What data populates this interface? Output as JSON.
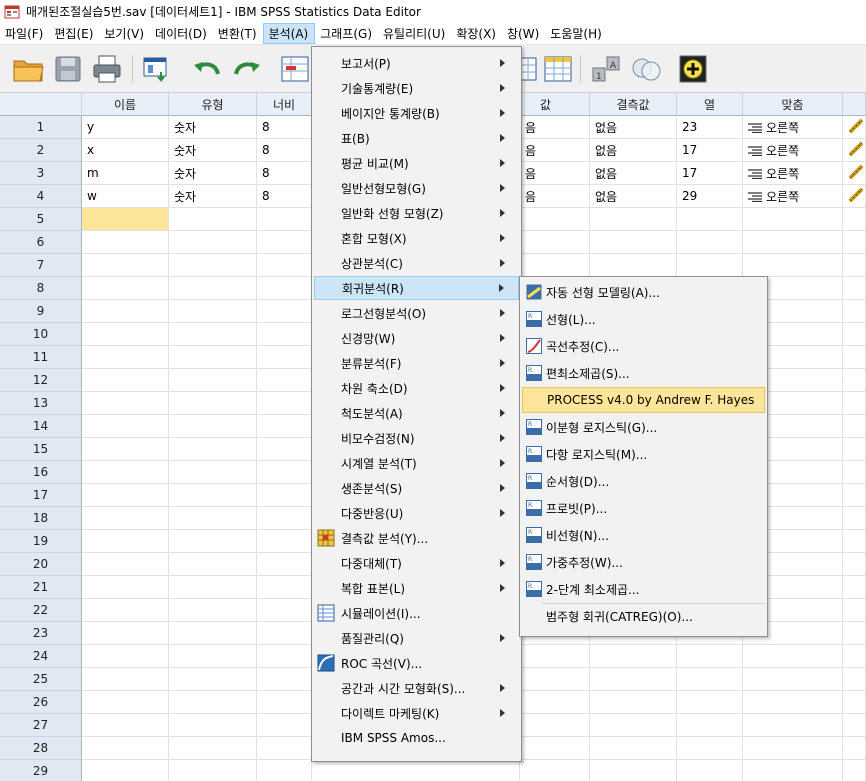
{
  "window": {
    "title": "매개된조절실습5번.sav [데이터세트1] - IBM SPSS Statistics Data Editor"
  },
  "menubar": [
    "파일(F)",
    "편집(E)",
    "보기(V)",
    "데이터(D)",
    "변환(T)",
    "분석(A)",
    "그래프(G)",
    "유틸리티(U)",
    "확장(X)",
    "창(W)",
    "도움말(H)"
  ],
  "toolbar": {
    "icons": [
      "open-folder-icon",
      "save-icon",
      "print-icon",
      "recall-dialog-icon",
      "undo-icon",
      "redo-icon",
      "goto-case-icon",
      "split-file-icon",
      "select-cases-icon",
      "weight-cases-icon",
      "value-labels-icon",
      "use-variable-sets-icon"
    ]
  },
  "grid": {
    "headers": [
      "이름",
      "유형",
      "너비",
      "값",
      "결측값",
      "열",
      "맞춤"
    ],
    "rows": [
      {
        "num": "1",
        "name": "y",
        "type": "숫자",
        "width": "8",
        "values": "음",
        "missing": "없음",
        "columns": "23",
        "align": "오른쪽"
      },
      {
        "num": "2",
        "name": "x",
        "type": "숫자",
        "width": "8",
        "values": "음",
        "missing": "없음",
        "columns": "17",
        "align": "오른쪽"
      },
      {
        "num": "3",
        "name": "m",
        "type": "숫자",
        "width": "8",
        "values": "음",
        "missing": "없음",
        "columns": "17",
        "align": "오른쪽"
      },
      {
        "num": "4",
        "name": "w",
        "type": "숫자",
        "width": "8",
        "values": "음",
        "missing": "없음",
        "columns": "29",
        "align": "오른쪽"
      }
    ],
    "empty_rows": [
      "5",
      "6",
      "7",
      "8",
      "9",
      "10",
      "11",
      "12",
      "13",
      "14",
      "15",
      "16",
      "17",
      "18",
      "19",
      "20",
      "21",
      "22",
      "23",
      "24",
      "25",
      "26",
      "27",
      "28",
      "29"
    ]
  },
  "analyze_menu": [
    {
      "label": "보고서(P)",
      "submenu": true,
      "icon": ""
    },
    {
      "label": "기술통계량(E)",
      "submenu": true,
      "icon": ""
    },
    {
      "label": "베이지안 통계량(B)",
      "submenu": true,
      "icon": ""
    },
    {
      "label": "표(B)",
      "submenu": true,
      "icon": ""
    },
    {
      "label": "평균 비교(M)",
      "submenu": true,
      "icon": ""
    },
    {
      "label": "일반선형모형(G)",
      "submenu": true,
      "icon": ""
    },
    {
      "label": "일반화 선형 모형(Z)",
      "submenu": true,
      "icon": ""
    },
    {
      "label": "혼합 모형(X)",
      "submenu": true,
      "icon": ""
    },
    {
      "label": "상관분석(C)",
      "submenu": true,
      "icon": ""
    },
    {
      "label": "회귀분석(R)",
      "submenu": true,
      "icon": "",
      "highlighted": true
    },
    {
      "label": "로그선형분석(O)",
      "submenu": true,
      "icon": ""
    },
    {
      "label": "신경망(W)",
      "submenu": true,
      "icon": ""
    },
    {
      "label": "분류분석(F)",
      "submenu": true,
      "icon": ""
    },
    {
      "label": "차원 축소(D)",
      "submenu": true,
      "icon": ""
    },
    {
      "label": "척도분석(A)",
      "submenu": true,
      "icon": ""
    },
    {
      "label": "비모수검정(N)",
      "submenu": true,
      "icon": ""
    },
    {
      "label": "시계열 분석(T)",
      "submenu": true,
      "icon": ""
    },
    {
      "label": "생존분석(S)",
      "submenu": true,
      "icon": ""
    },
    {
      "label": "다중반응(U)",
      "submenu": true,
      "icon": ""
    },
    {
      "label": "결측값 분석(Y)...",
      "submenu": false,
      "icon": "missing-value-analysis-icon"
    },
    {
      "label": "다중대체(T)",
      "submenu": true,
      "icon": ""
    },
    {
      "label": "복합 표본(L)",
      "submenu": true,
      "icon": ""
    },
    {
      "label": "시뮬레이션(I)...",
      "submenu": false,
      "icon": "simulation-icon"
    },
    {
      "label": "품질관리(Q)",
      "submenu": true,
      "icon": ""
    },
    {
      "label": "ROC 곡선(V)...",
      "submenu": false,
      "icon": "roc-curve-icon"
    },
    {
      "label": "공간과 시간 모형화(S)...",
      "submenu": true,
      "icon": ""
    },
    {
      "label": "다이렉트 마케팅(K)",
      "submenu": true,
      "icon": ""
    },
    {
      "label": "IBM SPSS Amos...",
      "submenu": false,
      "icon": ""
    }
  ],
  "regression_menu": [
    {
      "label": "자동 선형 모델링(A)...",
      "icon": "auto-linear-modeling-icon"
    },
    {
      "label": "선형(L)...",
      "icon": "linear-regression-icon",
      "tag": "LIN"
    },
    {
      "label": "곡선추정(C)...",
      "icon": "curve-estimation-icon"
    },
    {
      "label": "편최소제곱(S)...",
      "icon": "partial-least-squares-icon",
      "tag": "PLS"
    },
    {
      "label": "PROCESS v4.0 by Andrew F. Hayes",
      "icon": "",
      "highlighted": true
    },
    {
      "label": "이분형 로지스틱(G)...",
      "icon": "binary-logistic-icon",
      "tag": "BIN"
    },
    {
      "label": "다항 로지스틱(M)...",
      "icon": "multinomial-logistic-icon",
      "tag": "MLT"
    },
    {
      "label": "순서형(D)...",
      "icon": "ordinal-regression-icon",
      "tag": "ORD"
    },
    {
      "label": "프로빗(P)...",
      "icon": "probit-icon",
      "tag": "PRB"
    },
    {
      "label": "비선형(N)...",
      "icon": "nonlinear-regression-icon",
      "tag": "NLR"
    },
    {
      "label": "가중추정(W)...",
      "icon": "weight-estimation-icon",
      "tag": "WLS"
    },
    {
      "label": "2-단계 최소제곱...",
      "icon": "two-stage-least-squares-icon",
      "tag": "2SLS"
    },
    {
      "label": "범주형 회귀(CATREG)(O)...",
      "icon": ""
    }
  ]
}
